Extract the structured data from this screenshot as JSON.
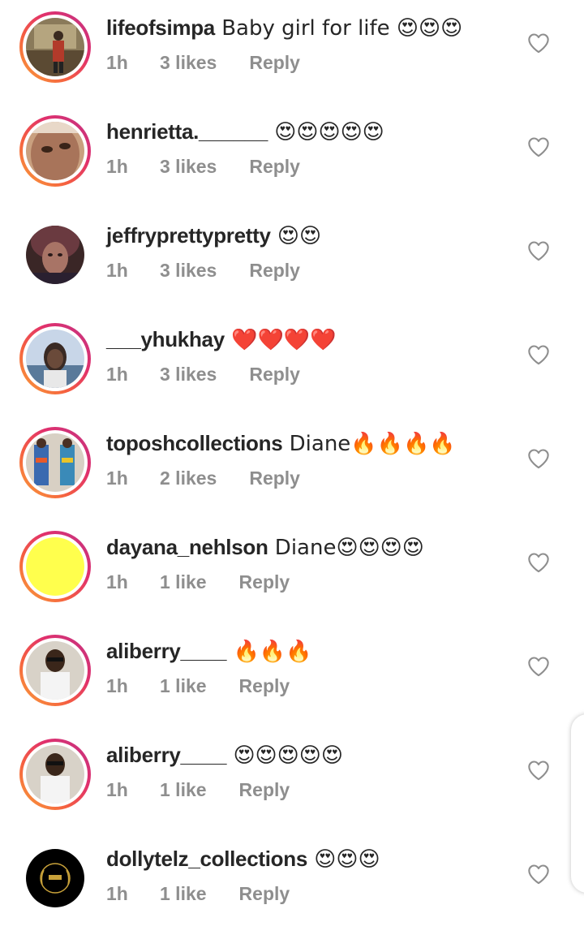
{
  "comments": [
    {
      "username": "lifeofsimpa",
      "text": " Baby girl for life 😍😍😍",
      "time": "1h",
      "likes": "3 likes",
      "reply": "Reply",
      "story_ring": true,
      "avatar_color": "#6b5a3e"
    },
    {
      "username": "henrietta.______",
      "text": " 😍😍😍😍😍",
      "time": "1h",
      "likes": "3 likes",
      "reply": "Reply",
      "story_ring": true,
      "avatar_color": "#a87a5e"
    },
    {
      "username": "jeffryprettypretty",
      "text": " 😍😍",
      "time": "1h",
      "likes": "3 likes",
      "reply": "Reply",
      "story_ring": false,
      "avatar_color": "#5a3a3a"
    },
    {
      "username": "___yhukhay",
      "text": " ❤️❤️❤️❤️",
      "time": "1h",
      "likes": "3 likes",
      "reply": "Reply",
      "story_ring": true,
      "avatar_color": "#8ea4c4"
    },
    {
      "username": "toposhcollections",
      "text": " Diane🔥🔥🔥🔥",
      "time": "1h",
      "likes": "2 likes",
      "reply": "Reply",
      "story_ring": true,
      "avatar_color": "#c9c3b8"
    },
    {
      "username": "dayana_nehlson",
      "text": " Diane😍😍😍😍",
      "time": "1h",
      "likes": "1 like",
      "reply": "Reply",
      "story_ring": true,
      "avatar_color": "#ffff4d"
    },
    {
      "username": "aliberry____",
      "text": " 🔥🔥🔥",
      "time": "1h",
      "likes": "1 like",
      "reply": "Reply",
      "story_ring": true,
      "avatar_color": "#d8d2c8"
    },
    {
      "username": "aliberry____",
      "text": " 😍😍😍😍😍",
      "time": "1h",
      "likes": "1 like",
      "reply": "Reply",
      "story_ring": true,
      "avatar_color": "#d8d2c8"
    },
    {
      "username": "dollytelz_collections",
      "text": " 😍😍😍",
      "time": "1h",
      "likes": "1 like",
      "reply": "Reply",
      "story_ring": false,
      "avatar_color": "#000000"
    }
  ],
  "icons": {
    "like": "heart-outline-icon"
  }
}
